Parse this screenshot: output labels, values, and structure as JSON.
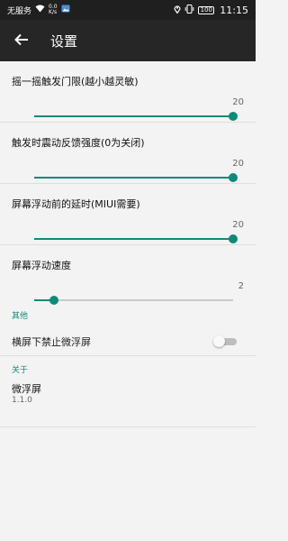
{
  "status_bar": {
    "carrier": "无服务",
    "net_speed_value": "0.0",
    "net_speed_unit": "K/s",
    "battery": "100",
    "time": "11:15",
    "icons": [
      "wifi-icon",
      "image-notification-icon",
      "location-icon",
      "vibrate-icon",
      "battery-icon"
    ]
  },
  "app_bar": {
    "title": "设置",
    "back_icon": "arrow-left-icon"
  },
  "accent_color": "#0f8a78",
  "seek_prefs": [
    {
      "title": "摇一摇触发门限(越小越灵敏)",
      "value": "20",
      "fraction": 1.0
    },
    {
      "title": "触发时震动反馈强度(0为关闭)",
      "value": "20",
      "fraction": 1.0
    },
    {
      "title": "屏幕浮动前的延时(MIUI需要)",
      "value": "20",
      "fraction": 1.0
    },
    {
      "title": "屏幕浮动速度",
      "value": "2",
      "fraction": 0.1
    }
  ],
  "other_section": {
    "header": "其他",
    "switch_label": "横屏下禁止微浮屏",
    "switch_on": false
  },
  "about_section": {
    "header": "关于",
    "app_name": "微浮屏",
    "version": "1.1.0"
  }
}
